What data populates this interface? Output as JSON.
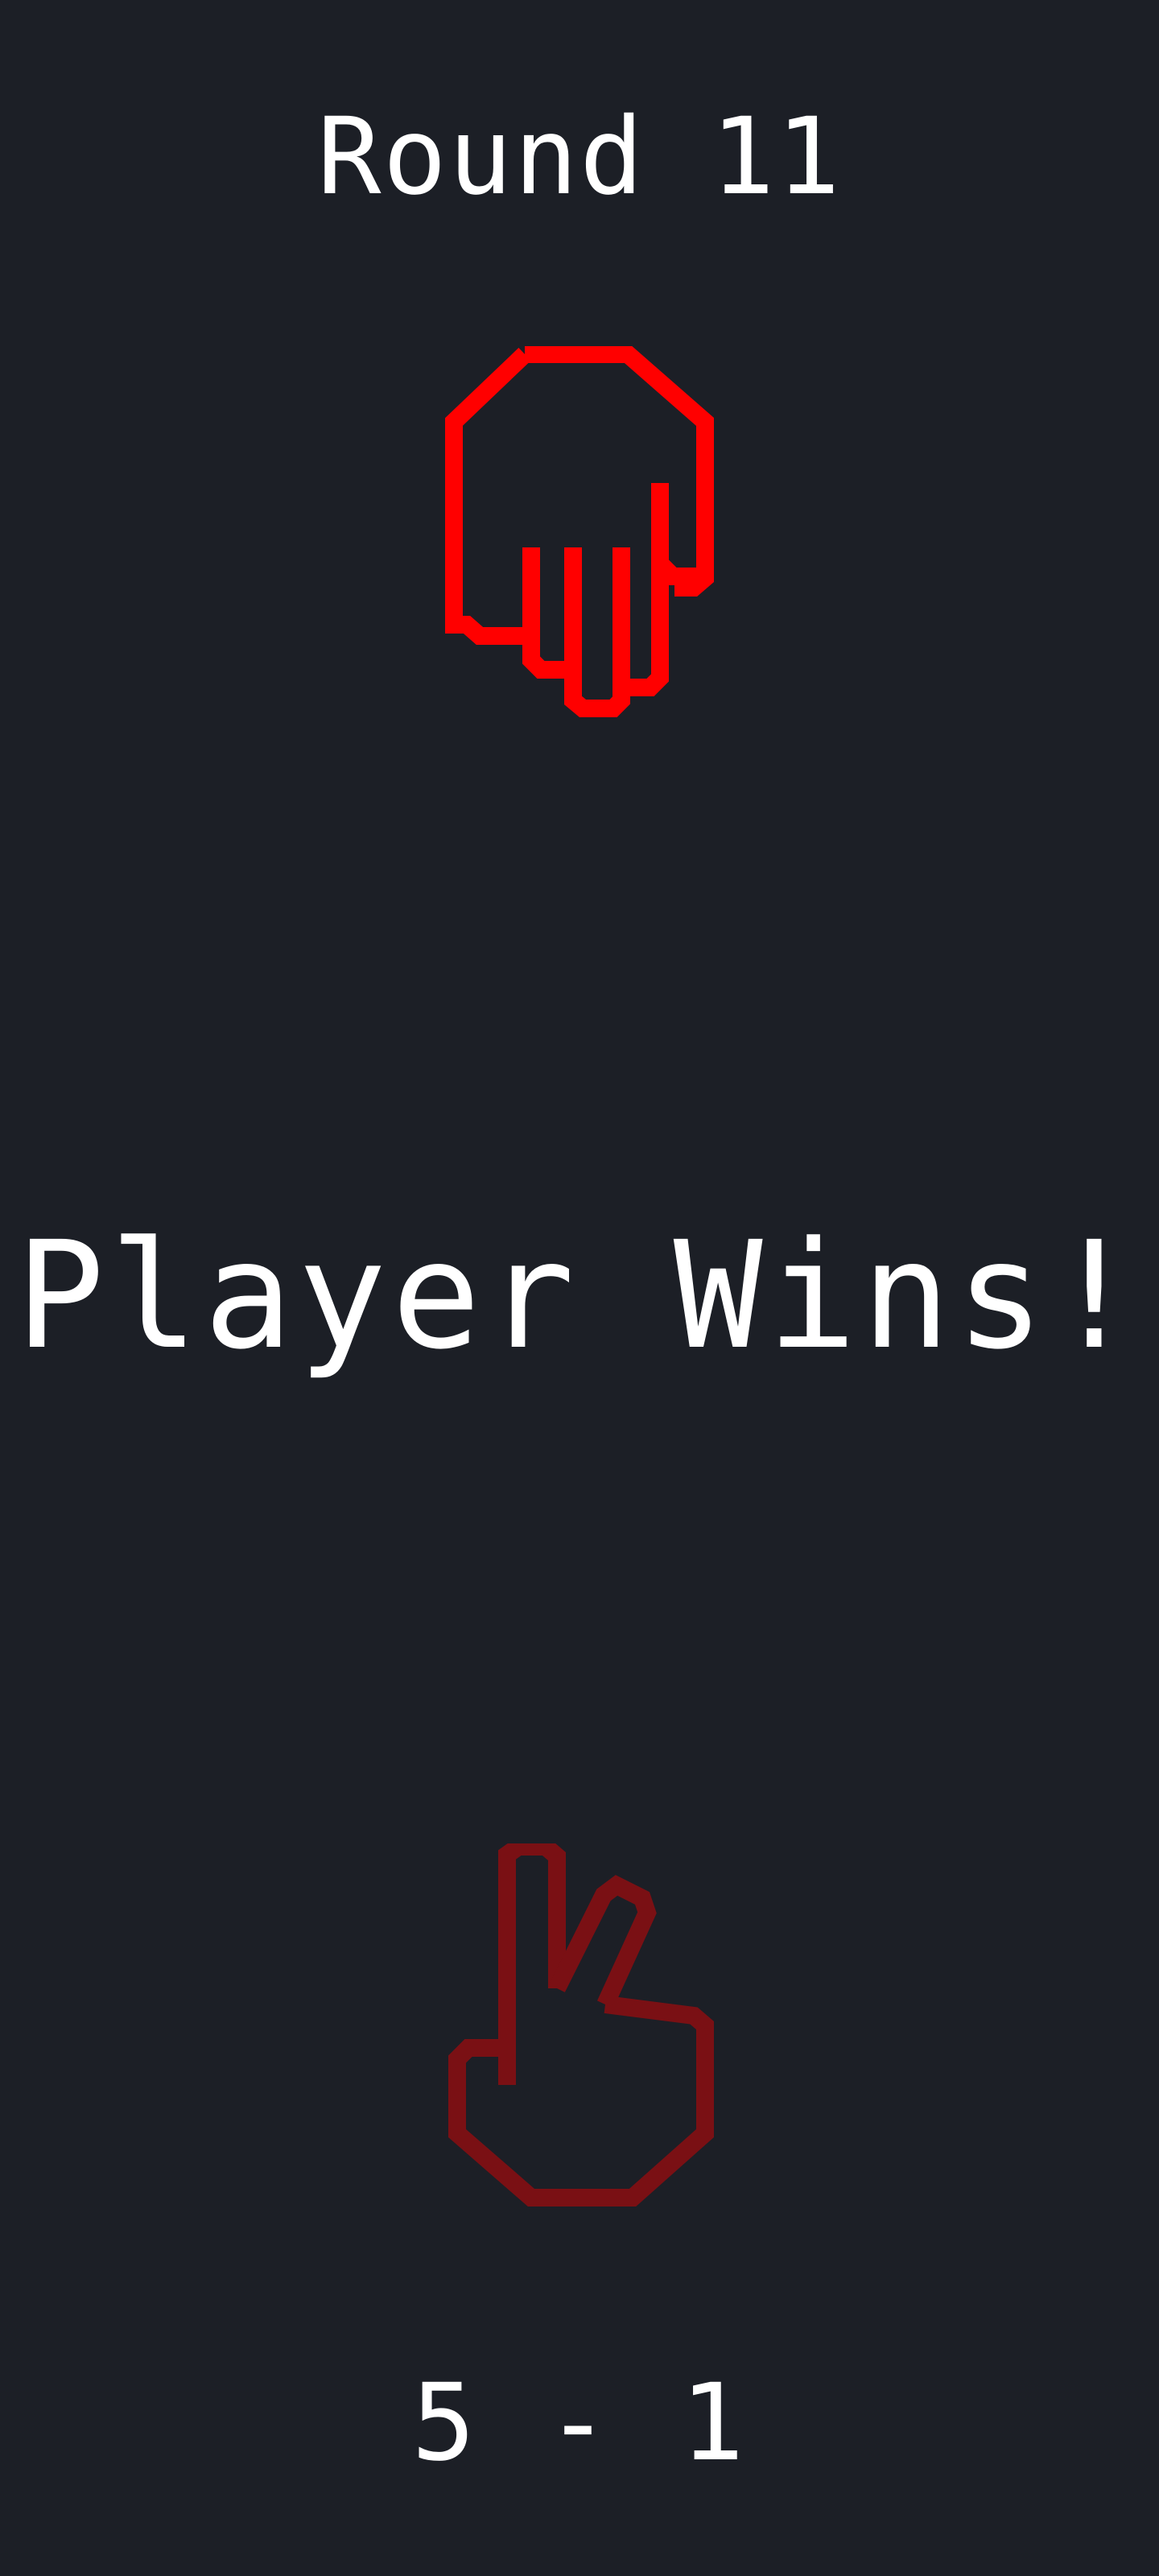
{
  "round": {
    "title": "Round 11"
  },
  "opponent": {
    "move_icon": "paper-hand-icon",
    "color": "#ff0000"
  },
  "result": {
    "text": "Player Wins!"
  },
  "player": {
    "move_icon": "scissors-hand-icon",
    "color": "#7a1014"
  },
  "score": {
    "text": "5 - 1"
  },
  "colors": {
    "background": "#1c1f26",
    "text": "#ffffff"
  }
}
